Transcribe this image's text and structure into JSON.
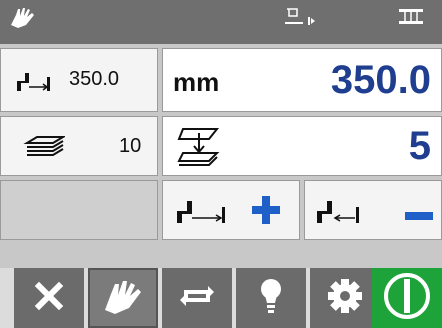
{
  "colors": {
    "topbar": "#6f6f6f",
    "value_blue": "#1f3e8f",
    "plus_blue": "#1f5fc8",
    "toolbar_gray": "#6b6b6b",
    "power_green": "#1ea33a"
  },
  "status_bar": {
    "icons": [
      "hand-icon",
      "measure-mode-icon",
      "gauge-mode-icon"
    ]
  },
  "length": {
    "label_value": "350.0",
    "unit": "mm",
    "value": "350.0"
  },
  "stack": {
    "label_value": "10",
    "count": "5"
  },
  "jog": {
    "increase_icon": "plus-icon",
    "decrease_icon": "minus-icon"
  },
  "toolbar": {
    "buttons": [
      "close-icon",
      "hand-icon",
      "cycle-icon",
      "light-bulb-icon",
      "gear-icon",
      "power-icon"
    ]
  }
}
